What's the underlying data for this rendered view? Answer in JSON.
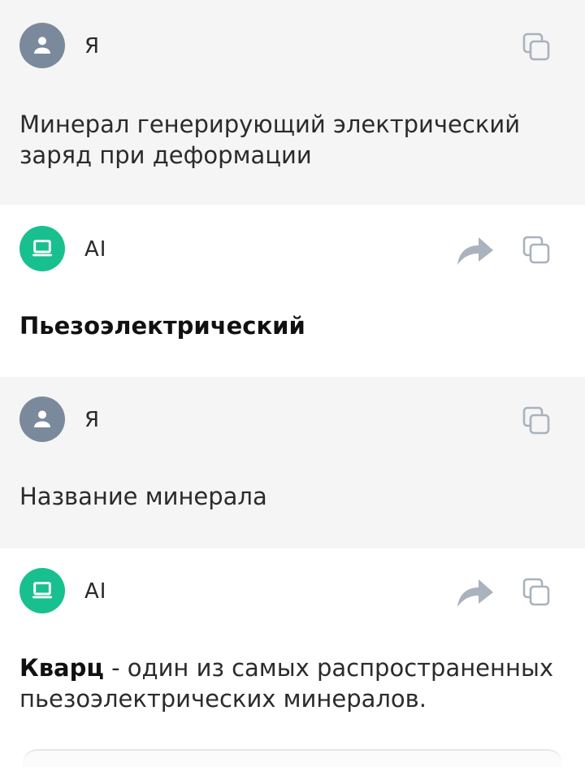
{
  "messages": [
    {
      "sender": "Я",
      "role": "user",
      "text": "Минерал генерирующий электрический заряд при деформации"
    },
    {
      "sender": "AI",
      "role": "ai",
      "bold": "Пьезоэлектрический",
      "text": ""
    },
    {
      "sender": "Я",
      "role": "user",
      "text": "Название минерала"
    },
    {
      "sender": "AI",
      "role": "ai",
      "bold": "Кварц",
      "text": " - один из самых распространенных пьезоэлектрических минералов."
    }
  ],
  "icons": {
    "user_avatar": "person-icon",
    "ai_avatar": "laptop-icon",
    "copy": "copy-icon",
    "share": "share-arrow-icon"
  },
  "colors": {
    "user_bg": "#f5f5f5",
    "ai_bg": "#ffffff",
    "user_avatar": "#7a8a9c",
    "ai_avatar": "#19c08f",
    "icon_gray": "#a9b2bd"
  }
}
